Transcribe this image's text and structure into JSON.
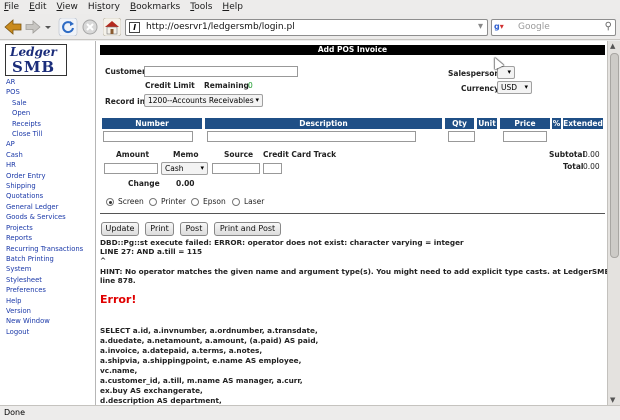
{
  "menubar": [
    {
      "pre": "",
      "key": "F",
      "post": "ile"
    },
    {
      "pre": "",
      "key": "E",
      "post": "dit"
    },
    {
      "pre": "",
      "key": "V",
      "post": "iew"
    },
    {
      "pre": "Hi",
      "key": "s",
      "post": "tory"
    },
    {
      "pre": "",
      "key": "B",
      "post": "ookmarks"
    },
    {
      "pre": "",
      "key": "T",
      "post": "ools"
    },
    {
      "pre": "",
      "key": "H",
      "post": "elp"
    }
  ],
  "navbar": {
    "url": "http://oesrvr1/ledgersmb/login.pl",
    "search_placeholder": "Google",
    "url_icon_letter": "l"
  },
  "logo": {
    "line1": "Ledger",
    "line2": "SMB"
  },
  "sidebar": [
    {
      "label": "AR",
      "sub": false
    },
    {
      "label": "POS",
      "sub": false
    },
    {
      "label": "Sale",
      "sub": true
    },
    {
      "label": "Open",
      "sub": true
    },
    {
      "label": "Receipts",
      "sub": true
    },
    {
      "label": "Close Till",
      "sub": true
    },
    {
      "label": "AP",
      "sub": false
    },
    {
      "label": "Cash",
      "sub": false
    },
    {
      "label": "HR",
      "sub": false
    },
    {
      "label": "Order Entry",
      "sub": false
    },
    {
      "label": "Shipping",
      "sub": false
    },
    {
      "label": "Quotations",
      "sub": false
    },
    {
      "label": "General Ledger",
      "sub": false
    },
    {
      "label": "Goods & Services",
      "sub": false
    },
    {
      "label": "Projects",
      "sub": false
    },
    {
      "label": "Reports",
      "sub": false
    },
    {
      "label": "Recurring Transactions",
      "sub": false
    },
    {
      "label": "Batch Printing",
      "sub": false
    },
    {
      "label": "System",
      "sub": false
    },
    {
      "label": "Stylesheet",
      "sub": false
    },
    {
      "label": "Preferences",
      "sub": false
    },
    {
      "label": "Help",
      "sub": false
    },
    {
      "label": "Version",
      "sub": false
    },
    {
      "label": "New Window",
      "sub": false
    },
    {
      "label": "Logout",
      "sub": false
    }
  ],
  "form": {
    "title": "Add POS Invoice",
    "customer_label": "Customer",
    "credit_limit_label": "Credit Limit",
    "remaining_label": "Remaining",
    "remaining_value": "0",
    "record_in_label": "Record in",
    "record_in_value": "1200--Accounts Receivables",
    "salesperson_label": "Salesperson",
    "currency_label": "Currency",
    "currency_value": "USD",
    "columns": [
      "Number",
      "Description",
      "Qty",
      "Unit",
      "Price",
      "%",
      "Extended"
    ],
    "amount_label": "Amount",
    "memo_label": "Memo",
    "memo_value": "Cash",
    "source_label": "Source",
    "cc_track_label": "Credit Card Track",
    "change_label": "Change",
    "change_value": "0.00",
    "subtotal_label": "Subtotal",
    "subtotal_value": "0.00",
    "total_label": "Total",
    "total_value": "0.00",
    "print_targets": [
      "Screen",
      "Printer",
      "Epson",
      "Laser"
    ],
    "buttons": [
      "Update",
      "Print",
      "Post",
      "Print and Post"
    ]
  },
  "error": {
    "lines": [
      "DBD::Pg::st execute failed: ERROR: operator does not exist: character varying = integer",
      "LINE 27: AND a.till = 115",
      "^",
      "HINT: No operator matches the given name and argument type(s). You might need to add explicit type casts. at LedgerSMB/AA.pm",
      "line 878."
    ],
    "title": "Error!",
    "sql": [
      "SELECT a.id, a.invnumber, a.ordnumber, a.transdate,",
      "a.duedate, a.netamount, a.amount, (a.paid) AS paid,",
      "a.invoice, a.datepaid, a.terms, a.notes,",
      "a.shipvia, a.shippingpoint, e.name AS employee,",
      "vc.name,",
      "a.customer_id, a.till, m.name AS manager, a.curr,",
      "ex.buy AS exchangerate,",
      "d.description AS department,"
    ]
  },
  "status": "Done"
}
